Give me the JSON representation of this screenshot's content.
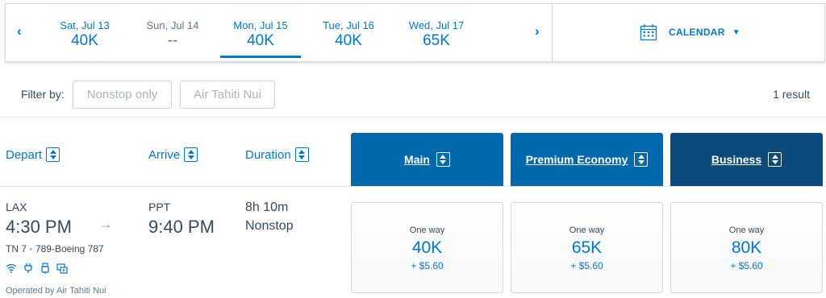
{
  "dates": [
    {
      "label": "Sat, Jul 13",
      "price": "40K"
    },
    {
      "label": "Sun, Jul 14",
      "price": "--"
    },
    {
      "label": "Mon, Jul 15",
      "price": "40K"
    },
    {
      "label": "Tue, Jul 16",
      "price": "40K"
    },
    {
      "label": "Wed, Jul 17",
      "price": "65K"
    }
  ],
  "calendar": {
    "label": "CALENDAR",
    "icon": "calendar-icon"
  },
  "filters": {
    "label": "Filter by:",
    "chips": [
      "Nonstop only",
      "Air Tahiti Nui"
    ]
  },
  "result_count": "1 result",
  "columns": {
    "depart": "Depart",
    "arrive": "Arrive",
    "duration": "Duration"
  },
  "cabins": [
    {
      "label": "Main",
      "color": "#0069ae"
    },
    {
      "label": "Premium Economy",
      "color": "#0069ae"
    },
    {
      "label": "Business",
      "color": "#0b4a7d"
    }
  ],
  "flight": {
    "origin": "LAX",
    "depart_time": "4:30 PM",
    "destination": "PPT",
    "arrive_time": "9:40 PM",
    "duration": "8h 10m",
    "stops": "Nonstop",
    "flight_number": "TN 7",
    "aircraft": "789-Boeing 787",
    "operated_by": "Operated by Air Tahiti Nui",
    "amenities": [
      "wifi-icon",
      "power-icon",
      "usb-icon",
      "entertainment-icon"
    ]
  },
  "fares": [
    {
      "type": "One way",
      "price": "40K",
      "fee": "+ $5.60"
    },
    {
      "type": "One way",
      "price": "65K",
      "fee": "+ $5.60"
    },
    {
      "type": "One way",
      "price": "80K",
      "fee": "+ $5.60"
    }
  ],
  "colors": {
    "accent": "#0078d2",
    "text": "#36495a"
  }
}
